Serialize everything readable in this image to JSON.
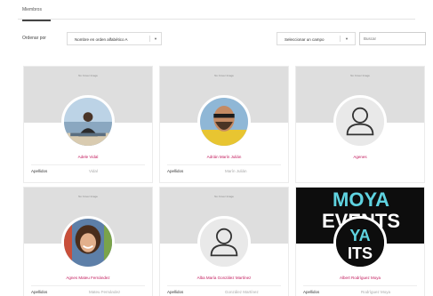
{
  "tabs": [
    {
      "label": "Miembros"
    }
  ],
  "toolbar": {
    "sort_label": "Ordenar por",
    "sort_value": "Nombre en orden alfabético A",
    "field_value": "Seleccionar un campo",
    "search_placeholder": "Buscar"
  },
  "cards": [
    {
      "cover_text": "No Cover Image",
      "name": "Adele Vidal",
      "field_label": "Apellidos",
      "field_value": "Vidal",
      "avatar": "photo"
    },
    {
      "cover_text": "No Cover Image",
      "name": "Adrián Marín Julián",
      "field_label": "Apellidos",
      "field_value": "Marín Julián",
      "avatar": "photo"
    },
    {
      "cover_text": "No Cover Image",
      "name": "Agenes",
      "field_label": "",
      "field_value": "",
      "avatar": "default-user-icon"
    },
    {
      "cover_text": "No Cover Image",
      "name": "Agnes Mateu Fernández",
      "field_label": "Apellidos",
      "field_value": "Mateu Fernández",
      "avatar": "photo"
    },
    {
      "cover_text": "No Cover Image",
      "name": "Alba María González Martínez",
      "field_label": "Apellidos",
      "field_value": "González Martínez",
      "avatar": "default-user-icon"
    },
    {
      "cover_text": "MOYA EVENTS",
      "name": "Albert Rodríguez Moya",
      "field_label": "Apellidos",
      "field_value": "Rodríguez Moya",
      "avatar": "logo"
    }
  ],
  "colors": {
    "name_link": "#c2185b",
    "tab_underline": "#444444",
    "cover_gray": "#dedede"
  }
}
